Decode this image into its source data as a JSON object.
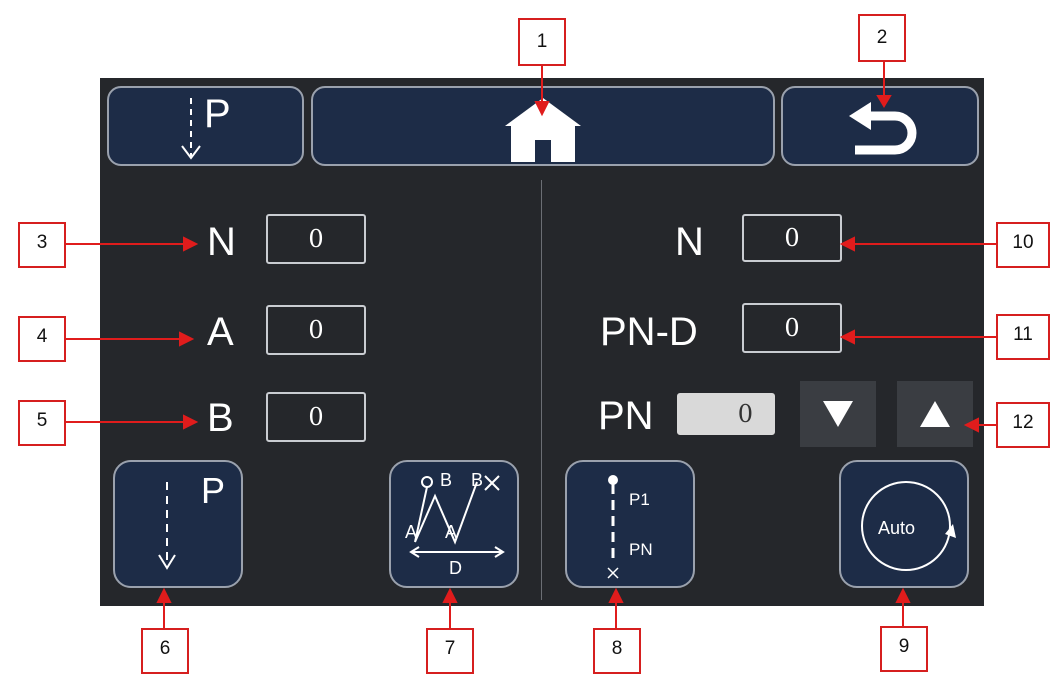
{
  "topbar": {
    "p_button_label": "P"
  },
  "left": {
    "n_label": "N",
    "n_value": "0",
    "a_label": "A",
    "a_value": "0",
    "b_label": "B",
    "b_value": "0"
  },
  "right": {
    "n_label": "N",
    "n_value": "0",
    "pnd_label": "PN-D",
    "pnd_value": "0",
    "pn_label": "PN",
    "pn_value": "0"
  },
  "bottom": {
    "p_label": "P",
    "pattern_labels": {
      "b1": "B",
      "b2": "B",
      "a1": "A",
      "a2": "A",
      "d": "D"
    },
    "p1_label": "P1",
    "pn_label": "PN",
    "auto_label": "Auto"
  },
  "callouts": [
    "1",
    "2",
    "3",
    "4",
    "5",
    "6",
    "7",
    "8",
    "9",
    "10",
    "11",
    "12"
  ],
  "colors": {
    "panel": "#25272b",
    "button": "#1d2c47",
    "callout_border": "#d61f1f",
    "arrow": "#e01c1c"
  }
}
